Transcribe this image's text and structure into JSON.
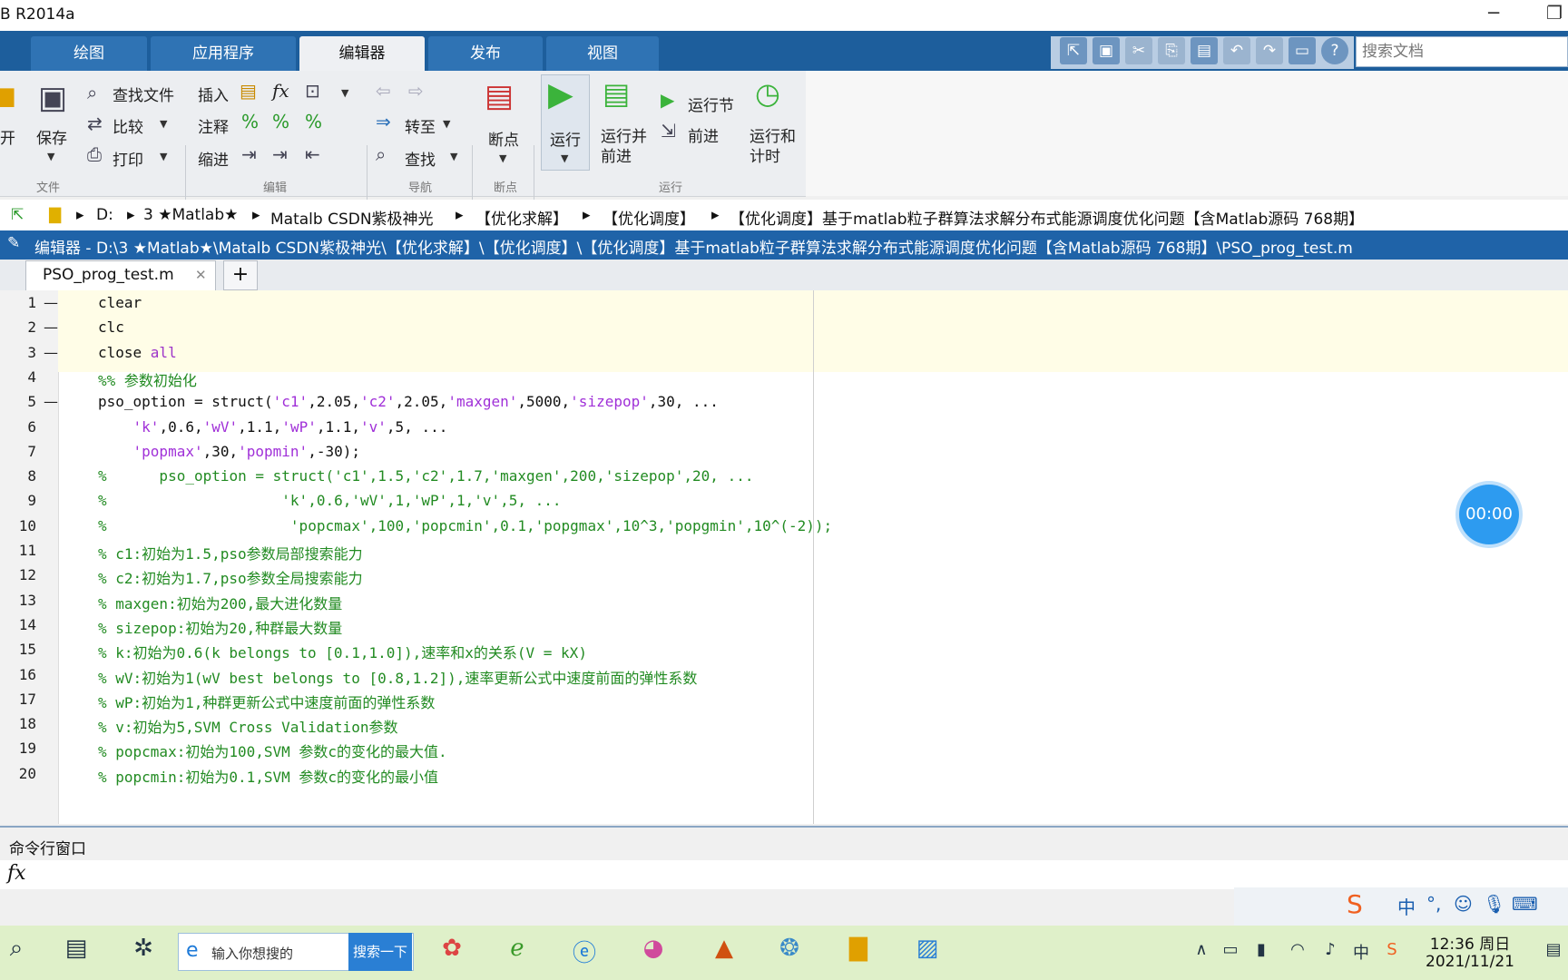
{
  "window": {
    "title": "B R2014a"
  },
  "tabs": [
    "绘图",
    "应用程序",
    "编辑器",
    "发布",
    "视图"
  ],
  "search": {
    "placeholder": "搜索文档"
  },
  "ribbon": {
    "file": {
      "open": "开",
      "save": "保存",
      "find_files": "查找文件",
      "compare": "比较",
      "print": "打印",
      "group": "文件"
    },
    "edit": {
      "insert": "插入",
      "comment": "注释",
      "indent": "缩进",
      "fx": "fx",
      "group": "编辑"
    },
    "nav": {
      "goto": "转至",
      "find": "查找",
      "group": "导航"
    },
    "breakpoints": {
      "label": "断点",
      "group": "断点"
    },
    "run": {
      "run": "运行",
      "run_advance": "运行并\n前进",
      "run_section": "运行节",
      "advance": "前进",
      "run_time": "运行和\n计时",
      "group": "运行"
    }
  },
  "address": {
    "parts": [
      "D:",
      "3 ★Matlab★",
      "Matalb CSDN紫极神光",
      "【优化求解】",
      "【优化调度】",
      "【优化调度】基于matlab粒子群算法求解分布式能源调度优化问题【含Matlab源码 768期】"
    ]
  },
  "editor": {
    "title": "编辑器 - D:\\3 ★Matlab★\\Matalb CSDN紫极神光\\【优化求解】\\【优化调度】\\【优化调度】基于matlab粒子群算法求解分布式能源调度优化问题【含Matlab源码 768期】\\PSO_prog_test.m",
    "file_tab": "PSO_prog_test.m",
    "add_tab": "+",
    "lines": [
      {
        "n": "1",
        "dash": "—",
        "text": "clear"
      },
      {
        "n": "2",
        "dash": "—",
        "text": "clc"
      },
      {
        "n": "3",
        "dash": "—",
        "text": "close all"
      },
      {
        "n": "4",
        "dash": "",
        "text": "%% 参数初始化"
      },
      {
        "n": "5",
        "dash": "—",
        "text": "pso_option = struct('c1',2.05,'c2',2.05,'maxgen',5000,'sizepop',30, ..."
      },
      {
        "n": "6",
        "dash": "",
        "text": "    'k',0.6,'wV',1.1,'wP',1.1,'v',5, ..."
      },
      {
        "n": "7",
        "dash": "",
        "text": "    'popmax',30,'popmin',-30);"
      },
      {
        "n": "8",
        "dash": "",
        "text": "%      pso_option = struct('c1',1.5,'c2',1.7,'maxgen',200,'sizepop',20, ..."
      },
      {
        "n": "9",
        "dash": "",
        "text": "%                    'k',0.6,'wV',1,'wP',1,'v',5, ..."
      },
      {
        "n": "10",
        "dash": "",
        "text": "%                     'popcmax',100,'popcmin',0.1,'popgmax',10^3,'popgmin',10^(-2));"
      },
      {
        "n": "11",
        "dash": "",
        "text": "% c1:初始为1.5,pso参数局部搜索能力"
      },
      {
        "n": "12",
        "dash": "",
        "text": "% c2:初始为1.7,pso参数全局搜索能力"
      },
      {
        "n": "13",
        "dash": "",
        "text": "% maxgen:初始为200,最大进化数量"
      },
      {
        "n": "14",
        "dash": "",
        "text": "% sizepop:初始为20,种群最大数量"
      },
      {
        "n": "15",
        "dash": "",
        "text": "% k:初始为0.6(k belongs to [0.1,1.0]),速率和x的关系(V = kX)"
      },
      {
        "n": "16",
        "dash": "",
        "text": "% wV:初始为1(wV best belongs to [0.8,1.2]),速率更新公式中速度前面的弹性系数"
      },
      {
        "n": "17",
        "dash": "",
        "text": "% wP:初始为1,种群更新公式中速度前面的弹性系数"
      },
      {
        "n": "18",
        "dash": "",
        "text": "% v:初始为5,SVM Cross Validation参数"
      },
      {
        "n": "19",
        "dash": "",
        "text": "% popcmax:初始为100,SVM 参数c的变化的最大值."
      },
      {
        "n": "20",
        "dash": "",
        "text": "% popcmin:初始为0.1,SVM 参数c的变化的最小值"
      }
    ]
  },
  "timer": "00:00",
  "command_window": {
    "title": "命令行窗口",
    "prompt": "fx"
  },
  "taskbar": {
    "search_placeholder": "输入你想搜的",
    "search_button": "搜索一下",
    "time": "12:36 周日",
    "date": "2021/11/21",
    "ime": "中"
  }
}
